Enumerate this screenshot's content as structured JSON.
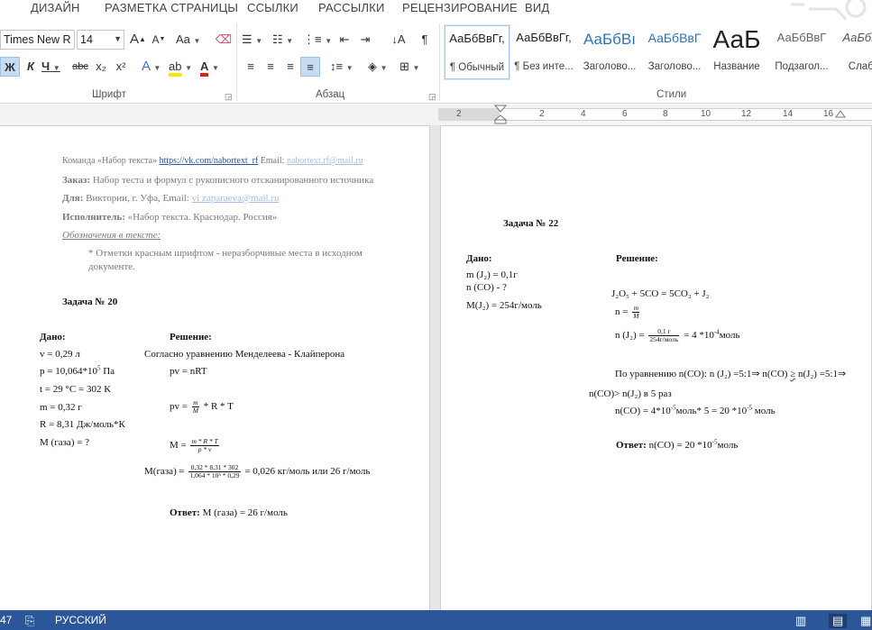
{
  "tabs": [
    "ДИЗАЙН",
    "РАЗМЕТКА СТРАНИЦЫ",
    "ССЫЛКИ",
    "РАССЫЛКИ",
    "РЕЦЕНЗИРОВАНИЕ",
    "ВИД"
  ],
  "ribbon": {
    "font_name": "Times New R",
    "font_size": "14",
    "group_font": "Шрифт",
    "group_paragraph": "Абзац",
    "group_styles": "Стили",
    "btn_grow": "A",
    "btn_shrink": "A",
    "btn_case": "Aa",
    "btn_bold": "Ж",
    "btn_italic": "К",
    "btn_underline": "Ч",
    "btn_strike": "abc",
    "btn_sub": "x₂",
    "btn_sup": "x²",
    "btn_pilcrow": "¶",
    "styles": [
      {
        "sample": "АаБбВвГг,",
        "name": "¶ Обычный"
      },
      {
        "sample": "АаБбВвГг,",
        "name": "¶ Без инте..."
      },
      {
        "sample": "АаБбВı",
        "name": "Заголово..."
      },
      {
        "sample": "АаБбВвГ",
        "name": "Заголово..."
      },
      {
        "sample": "АаБ",
        "name": "Название"
      },
      {
        "sample": "АаБбВвГ",
        "name": "Подзагол..."
      },
      {
        "sample": "АаБбВв",
        "name": "Слабо"
      }
    ]
  },
  "ruler": [
    "2",
    "2",
    "4",
    "6",
    "8",
    "10",
    "12",
    "14",
    "16"
  ],
  "page1": {
    "team_prefix": "Команда «Набор текста»",
    "team_link": "https://vk.com/nabortext_rf",
    "email_label": "Email:",
    "team_email": "nabortext.rf@mail.ru",
    "order_label": "Заказ:",
    "order_text": "Набор теста и формул с рукописного отсканированного источника",
    "for_label": "Для:",
    "for_text": "Виктории, г. Уфа, Email:",
    "for_email": "vi zaparaeva@mail.ru",
    "exec_label": "Исполнитель:",
    "exec_text": "«Набор текста. Краснодар. Россия»",
    "legend_label": "Обозначения в тексте:",
    "legend_line1": "* Отметки красным шрифтом - неразборчивые места в исходном",
    "legend_line2": "документе.",
    "task_title": "Задача № 20",
    "given_title": "Дано:",
    "given": [
      "v = 0,29 л",
      "p = 10,064*10",
      "t = 29 °C = 302 K",
      "m = 0,32 г",
      "R = 8,31 Дж/моль*К",
      "M (газа) = ?"
    ],
    "p_exp": "5",
    "p_unit": " Па",
    "solution_title": "Решение:",
    "sol_intro": "Согласно уравнению Менделеева - Клайперона",
    "eq1": "pv = nRT",
    "eq2_left": "pv =",
    "eq2_num": "m",
    "eq2_den": "M",
    "eq2_right": "* R * T",
    "eq3_left": "M =",
    "eq3_num": "m * R * T",
    "eq3_den": "p * v",
    "eq4_left": "M(газа) =",
    "eq4_num": "0,32 * 8,31 * 302",
    "eq4_den": "1,064 * 10⁵ * 0,29",
    "eq4_right": "= 0,026 кг/моль или 26 г/моль",
    "answer_label": "Ответ:",
    "answer_text": "M (газа) = 26 г/моль"
  },
  "page2": {
    "task_title": "Задача № 22",
    "given_title": "Дано:",
    "given1": "m (J₂) = 0,1г",
    "given2": "n (CO) - ?",
    "given3": "M(J₂) = 254г/моль",
    "solution_title": "Решение:",
    "reaction": "J₂O₅ + 5CO = 5CO₂ + J₂",
    "n_left": "n =",
    "n_num": "m",
    "n_den": "M",
    "nJ_left": "n (J₂) =",
    "nJ_num": "0,1 г",
    "nJ_den": "254г/моль",
    "nJ_right": "= 4 *10",
    "nJ_exp": "-4",
    "nJ_unit": "моль",
    "eq_line1": "По уравнению n(CO): n (J₂) =5:1⇒ n(CO)",
    "eq_line1_ge": "≥",
    "eq_line1_end": "n(J₂) =5:1⇒",
    "eq_line2": "n(CO)> n(J₂) в 5 раз",
    "eq_line3a": "n(CO) = 4*10",
    "eq_line3_exp1": "-5",
    "eq_line3b": "моль* 5 = 20 *10",
    "eq_line3_exp2": "-5",
    "eq_line3c": " моль",
    "answer_label": "Ответ:",
    "answer_text": "n(CO) = 20 *10",
    "answer_exp": "-5",
    "answer_unit": "моль"
  },
  "status": {
    "page_num": "47",
    "language": "РУССКИЙ"
  },
  "colors": {
    "statusbar": "#2b579a",
    "accent": "#2b579a"
  }
}
